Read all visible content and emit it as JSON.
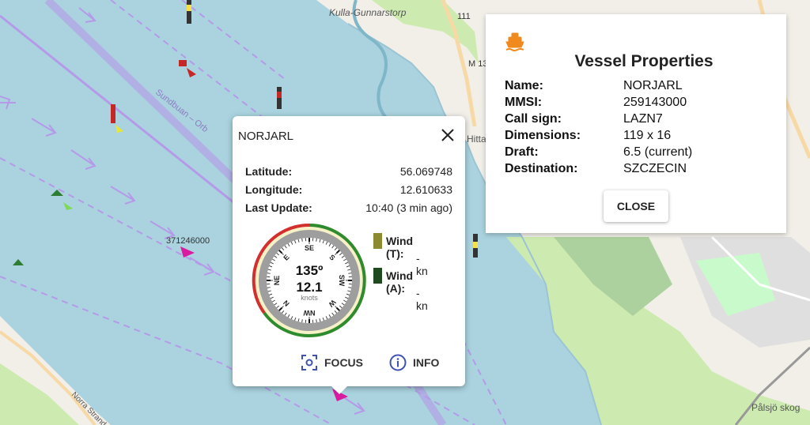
{
  "map": {
    "place_labels": [
      "Kulla-Gunnarstorp",
      "Hittar",
      "Pålsjö skog",
      "Norra Strand"
    ],
    "road_labels": [
      "111",
      "M 13"
    ],
    "ship_label": "371246000",
    "channel_label": "Sundbuan – Orb"
  },
  "popup": {
    "vessel_name": "NORJARL",
    "latitude_label": "Latitude:",
    "latitude": "56.069748",
    "longitude_label": "Longitude:",
    "longitude": "12.610633",
    "last_update_label": "Last Update:",
    "last_update": "10:40 (3 min ago)",
    "compass": {
      "heading": "135º",
      "speed": "12.1",
      "speed_unit": "knots",
      "labels": [
        "SE",
        "S",
        "SW",
        "W",
        "NW",
        "N",
        "NE",
        "E"
      ]
    },
    "wind_true_label": "Wind (T):",
    "wind_true_value": "- kn",
    "wind_apparent_label": "Wind (A):",
    "wind_apparent_value": "- kn",
    "focus_label": "FOCUS",
    "info_label": "INFO",
    "colors": {
      "wind_true": "#8a8a2e",
      "wind_apparent": "#1f4a1f"
    }
  },
  "properties": {
    "title": "Vessel Properties",
    "rows": [
      {
        "key": "Name:",
        "value": "NORJARL"
      },
      {
        "key": "MMSI:",
        "value": "259143000"
      },
      {
        "key": "Call sign:",
        "value": "LAZN7"
      },
      {
        "key": "Dimensions:",
        "value": "119 x 16"
      },
      {
        "key": "Draft:",
        "value": "6.5 (current)"
      },
      {
        "key": "Destination:",
        "value": "SZCZECIN"
      }
    ],
    "close_label": "CLOSE",
    "icon_color": "#f08a1c"
  }
}
